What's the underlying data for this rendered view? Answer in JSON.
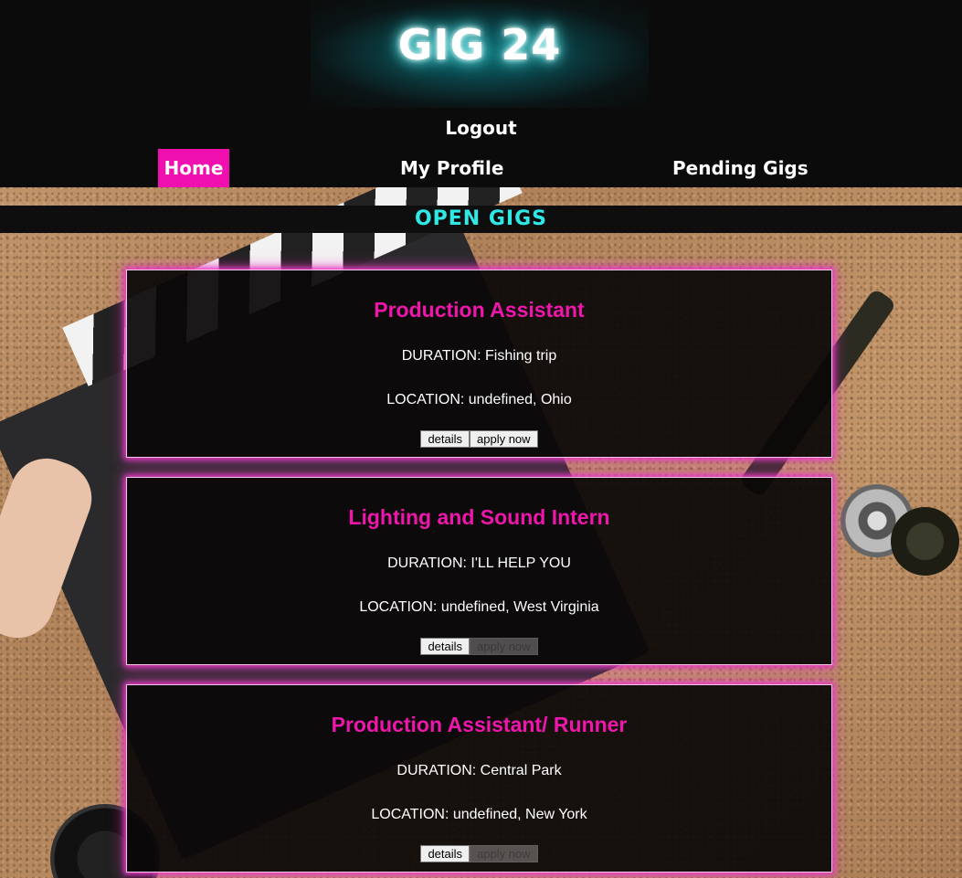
{
  "header": {
    "logo": "GIG 24",
    "logout_label": "Logout"
  },
  "nav": {
    "items": [
      {
        "label": "Home",
        "active": true
      },
      {
        "label": "My Profile",
        "active": false
      },
      {
        "label": "Pending Gigs",
        "active": false
      }
    ]
  },
  "section": {
    "title": "OPEN GIGS"
  },
  "gigs": [
    {
      "title": "Production Assistant",
      "duration": "DURATION: Fishing trip",
      "location": "LOCATION: undefined, Ohio",
      "details_label": "details",
      "apply_label": "apply now",
      "apply_enabled": true
    },
    {
      "title": "Lighting and Sound Intern",
      "duration": "DURATION: I'LL HELP YOU",
      "location": "LOCATION: undefined, West Virginia",
      "details_label": "details",
      "apply_label": "apply now",
      "apply_enabled": false
    },
    {
      "title": "Production Assistant/ Runner",
      "duration": "DURATION: Central Park",
      "location": "LOCATION: undefined, New York",
      "details_label": "details",
      "apply_label": "apply now",
      "apply_enabled": false
    }
  ],
  "colors": {
    "accent_pink": "#ee16ab",
    "accent_cyan": "#2fe9e6",
    "header_bg": "#0b0b0b"
  }
}
